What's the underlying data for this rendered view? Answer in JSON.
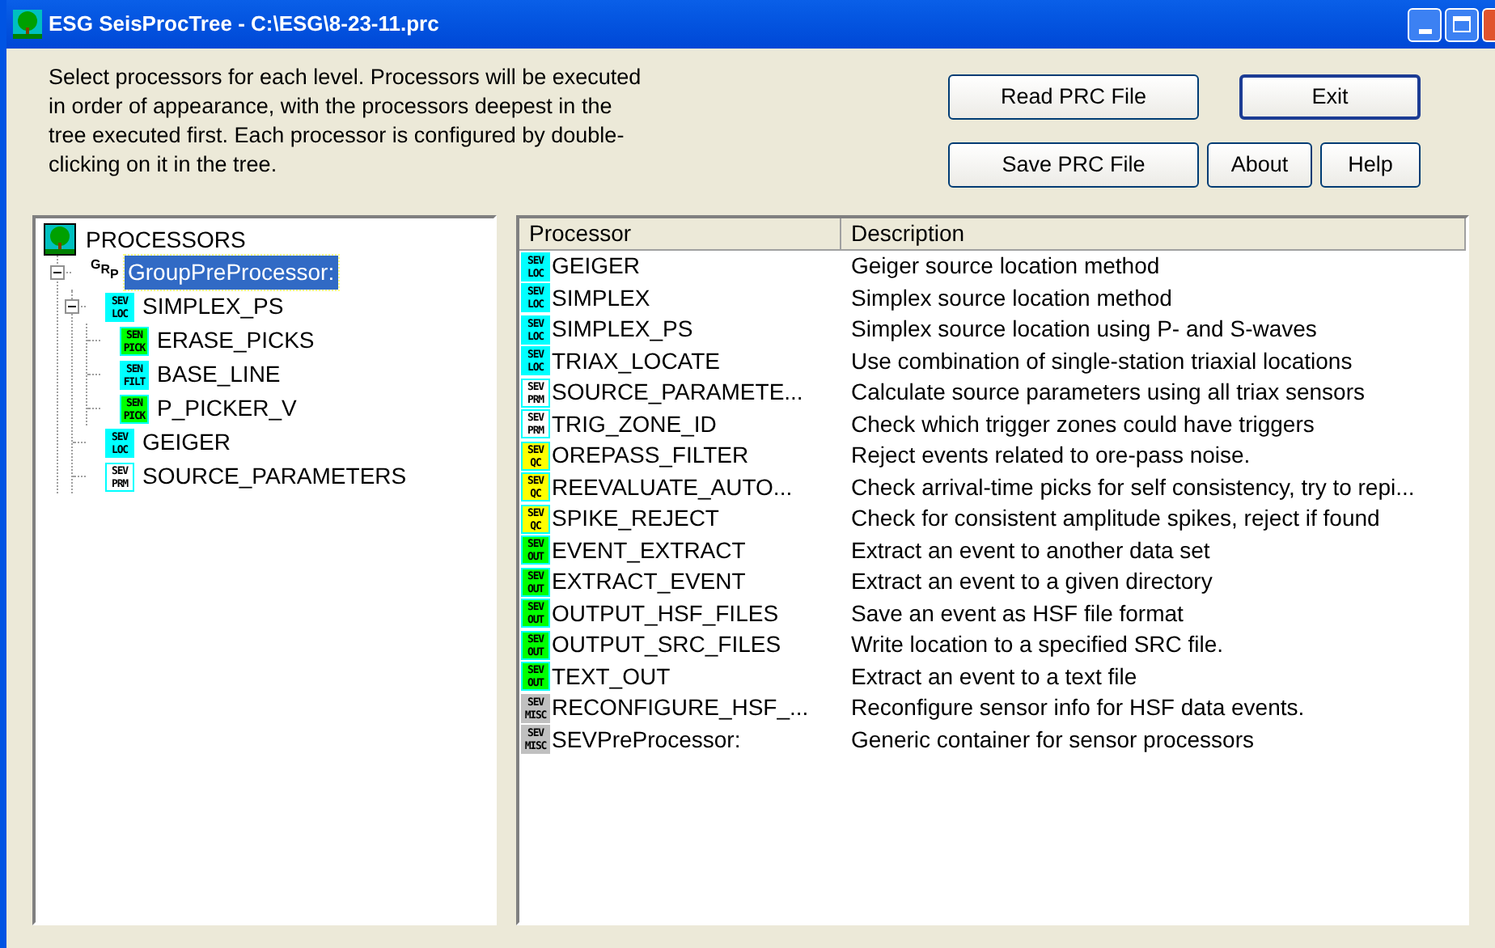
{
  "window": {
    "title": "ESG SeisProcTree - C:\\ESG\\8-23-11.prc"
  },
  "instructions": "Select processors for each level.  Processors will be executed in order of appearance, with the processors deepest in the tree executed first.  Each processor is configured by double-clicking on it in the tree.",
  "buttons": [
    {
      "label": "Read PRC File",
      "default": false
    },
    {
      "label": "Exit",
      "default": true
    },
    {
      "label": "Save PRC File",
      "default": false
    },
    {
      "label": "About",
      "default": false
    },
    {
      "label": "Help",
      "default": false
    }
  ],
  "tree": {
    "label": "PROCESSORS",
    "children": [
      {
        "label": "GroupPreProcessor:",
        "kind": "group",
        "badge": "GRP",
        "selected": true,
        "expanded": true,
        "children": [
          {
            "label": "SIMPLEX_PS",
            "kind": "tag",
            "badge_top": "SEV",
            "badge_bottom": "LOC",
            "color": "#00ffff",
            "selected": false,
            "expanded": true,
            "children": [
              {
                "label": "ERASE_PICKS",
                "kind": "tag",
                "badge_top": "SEN",
                "badge_bottom": "PICK",
                "color": "#00ff00",
                "selected": false
              },
              {
                "label": "BASE_LINE",
                "kind": "tag",
                "badge_top": "SEN",
                "badge_bottom": "FILT",
                "color": "#00ffff",
                "selected": false
              },
              {
                "label": "P_PICKER_V",
                "kind": "tag",
                "badge_top": "SEN",
                "badge_bottom": "PICK",
                "color": "#00ff00",
                "selected": false
              }
            ]
          },
          {
            "label": "GEIGER",
            "kind": "tag",
            "badge_top": "SEV",
            "badge_bottom": "LOC",
            "color": "#00ffff",
            "selected": false
          },
          {
            "label": "SOURCE_PARAMETERS",
            "kind": "tag",
            "badge_top": "SEV",
            "badge_bottom": "PRM",
            "color": "#ffffff",
            "selected": false
          }
        ]
      }
    ]
  },
  "table": {
    "columns": [
      "Processor",
      "Description"
    ],
    "rows": [
      {
        "badge_top": "SEV",
        "badge_bottom": "LOC",
        "color": "#00ffff",
        "processor": "GEIGER",
        "description": "Geiger source location method"
      },
      {
        "badge_top": "SEV",
        "badge_bottom": "LOC",
        "color": "#00ffff",
        "processor": "SIMPLEX",
        "description": "Simplex source location method"
      },
      {
        "badge_top": "SEV",
        "badge_bottom": "LOC",
        "color": "#00ffff",
        "processor": "SIMPLEX_PS",
        "description": "Simplex source location using P- and S-waves"
      },
      {
        "badge_top": "SEV",
        "badge_bottom": "LOC",
        "color": "#00ffff",
        "processor": "TRIAX_LOCATE",
        "description": "Use combination of single-station triaxial locations"
      },
      {
        "badge_top": "SEV",
        "badge_bottom": "PRM",
        "color": "#ffffff",
        "processor": "SOURCE_PARAMETE...",
        "description": "Calculate source parameters using all triax sensors"
      },
      {
        "badge_top": "SEV",
        "badge_bottom": "PRM",
        "color": "#ffffff",
        "processor": "TRIG_ZONE_ID",
        "description": "Check which trigger zones could have triggers"
      },
      {
        "badge_top": "SEV",
        "badge_bottom": "QC",
        "color": "#ffff00",
        "processor": "OREPASS_FILTER",
        "description": "Reject events related to ore-pass noise."
      },
      {
        "badge_top": "SEV",
        "badge_bottom": "QC",
        "color": "#ffff00",
        "processor": "REEVALUATE_AUTO...",
        "description": "Check arrival-time picks for self consistency, try to repi..."
      },
      {
        "badge_top": "SEV",
        "badge_bottom": "QC",
        "color": "#ffff00",
        "processor": "SPIKE_REJECT",
        "description": "Check for consistent amplitude spikes, reject if found"
      },
      {
        "badge_top": "SEV",
        "badge_bottom": "OUT",
        "color": "#00ff00",
        "processor": "EVENT_EXTRACT",
        "description": "Extract an event to another data set"
      },
      {
        "badge_top": "SEV",
        "badge_bottom": "OUT",
        "color": "#00ff00",
        "processor": "EXTRACT_EVENT",
        "description": "Extract an event to a given directory"
      },
      {
        "badge_top": "SEV",
        "badge_bottom": "OUT",
        "color": "#00ff00",
        "processor": "OUTPUT_HSF_FILES",
        "description": "Save an event as HSF file format"
      },
      {
        "badge_top": "SEV",
        "badge_bottom": "OUT",
        "color": "#00ff00",
        "processor": "OUTPUT_SRC_FILES",
        "description": "Write location to a specified SRC file."
      },
      {
        "badge_top": "SEV",
        "badge_bottom": "OUT",
        "color": "#00ff00",
        "processor": "TEXT_OUT",
        "description": "Extract an event to a text file"
      },
      {
        "badge_top": "SEV",
        "badge_bottom": "MISC",
        "color": "#c0c0c0",
        "processor": "RECONFIGURE_HSF_...",
        "description": "Reconfigure sensor info for HSF data events."
      },
      {
        "badge_top": "SEV",
        "badge_bottom": "MISC",
        "color": "#c0c0c0",
        "processor": "SEVPreProcessor:",
        "description": "Generic container for sensor processors"
      }
    ]
  }
}
